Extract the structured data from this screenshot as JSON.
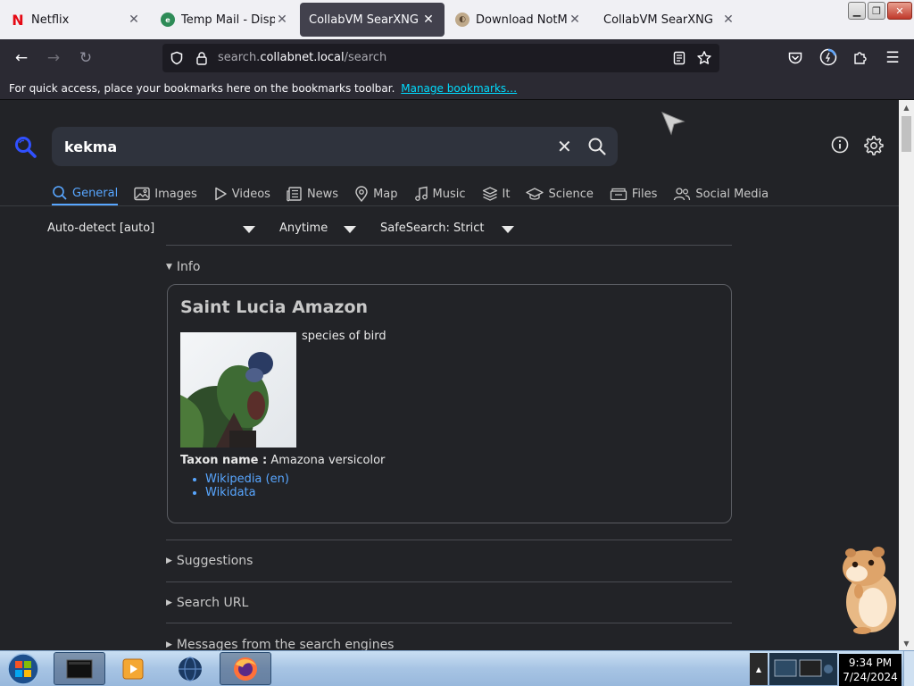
{
  "browser": {
    "tabs": [
      {
        "title": "Netflix",
        "icon": "netflix-icon",
        "active": false
      },
      {
        "title": "Temp Mail - Disposable",
        "icon": "temp-mail-icon",
        "active": false
      },
      {
        "title": "CollabVM SearXNG",
        "icon": "",
        "active": true
      },
      {
        "title": "Download NotMyFault",
        "icon": "download-icon",
        "active": false
      },
      {
        "title": "CollabVM SearXNG",
        "icon": "",
        "active": false
      }
    ],
    "url": {
      "prefix": "search.",
      "host": "collabnet.local",
      "path": "/search"
    },
    "bookmarks_text": "For quick access, place your bookmarks here on the bookmarks toolbar.",
    "bookmarks_link": "Manage bookmarks…"
  },
  "search": {
    "query": "kekma",
    "categories": [
      {
        "label": "General",
        "icon": "search-icon"
      },
      {
        "label": "Images",
        "icon": "image-icon"
      },
      {
        "label": "Videos",
        "icon": "play-icon"
      },
      {
        "label": "News",
        "icon": "newspaper-icon"
      },
      {
        "label": "Map",
        "icon": "map-pin-icon"
      },
      {
        "label": "Music",
        "icon": "music-icon"
      },
      {
        "label": "It",
        "icon": "layers-icon"
      },
      {
        "label": "Science",
        "icon": "graduation-cap-icon"
      },
      {
        "label": "Files",
        "icon": "files-icon"
      },
      {
        "label": "Social Media",
        "icon": "people-icon"
      }
    ],
    "filters": {
      "language": "Auto-detect [auto]",
      "time": "Anytime",
      "safesearch": "SafeSearch: Strict"
    }
  },
  "infobox": {
    "section_label": "Info",
    "title": "Saint Lucia Amazon",
    "description": "species of bird",
    "taxon_label": "Taxon name :",
    "taxon_value": "Amazona versicolor",
    "links": [
      "Wikipedia (en)",
      "Wikidata"
    ]
  },
  "sections": [
    "Suggestions",
    "Search URL",
    "Messages from the search engines"
  ],
  "taskbar": {
    "time": "9:34 PM",
    "date": "7/24/2024"
  },
  "colors": {
    "accent": "#58a6ff",
    "page_bg": "#222327",
    "search_box": "#2f333d"
  }
}
